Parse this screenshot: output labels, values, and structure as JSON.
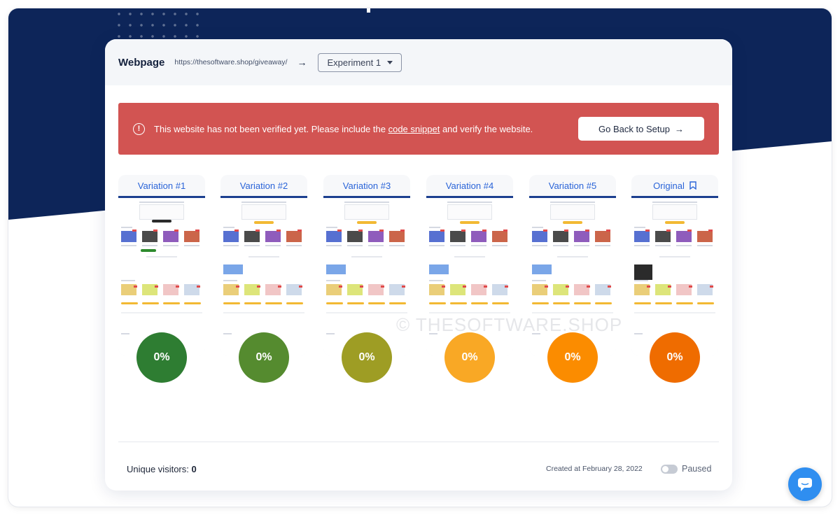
{
  "header": {
    "title": "Webpage",
    "url": "https://thesoftware.shop/giveaway/",
    "experiment_select": "Experiment 1"
  },
  "alert": {
    "text_before": "This website has not been verified yet. Please include the ",
    "link_text": "code snippet",
    "text_after": " and verify the website.",
    "button_label": "Go Back to Setup",
    "color": "#d25452"
  },
  "variations": [
    {
      "label": "Variation #1",
      "percent": "0%",
      "color": "#2e7d32"
    },
    {
      "label": "Variation #2",
      "percent": "0%",
      "color": "#558b2f"
    },
    {
      "label": "Variation #3",
      "percent": "0%",
      "color": "#9e9d24"
    },
    {
      "label": "Variation #4",
      "percent": "0%",
      "color": "#f9a825"
    },
    {
      "label": "Variation #5",
      "percent": "0%",
      "color": "#fb8c00"
    },
    {
      "label": "Original",
      "percent": "0%",
      "color": "#ef6c00",
      "icon": "bookmark-icon"
    }
  ],
  "watermark": "© THESOFTWARE.SHOP",
  "footer": {
    "visitors_label": "Unique visitors:",
    "visitors_count": "0",
    "created": "Created at February 28, 2022",
    "status": "Paused"
  },
  "colors": {
    "navy": "#0d2559",
    "link_blue": "#2a64d8",
    "chat": "#2f8ef0"
  }
}
